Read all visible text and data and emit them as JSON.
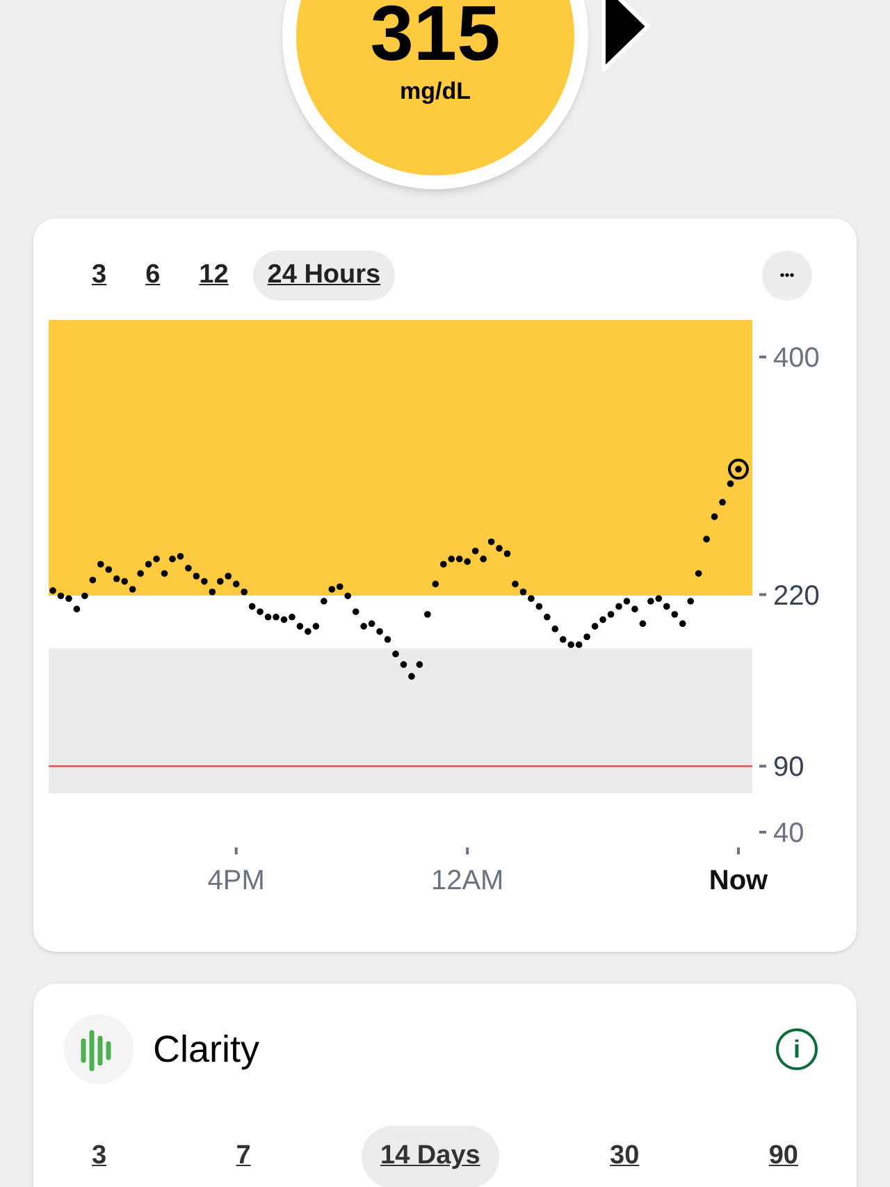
{
  "reading": {
    "value": "315",
    "unit": "mg/dL"
  },
  "graph": {
    "ranges": [
      {
        "label": "3",
        "selected": false
      },
      {
        "label": "6",
        "selected": false
      },
      {
        "label": "12",
        "selected": false
      },
      {
        "label": "24 Hours",
        "selected": true
      }
    ],
    "more": "•••",
    "chart_data": {
      "type": "scatter",
      "ylim": [
        40,
        428
      ],
      "yticks": [
        400,
        220,
        90,
        40
      ],
      "categories": [
        null,
        null,
        null,
        null,
        null,
        null,
        null,
        null,
        null,
        null,
        null,
        null,
        null,
        null,
        null,
        null,
        null,
        null,
        null,
        null,
        null,
        null,
        null,
        "4PM",
        null,
        null,
        null,
        null,
        null,
        null,
        null,
        null,
        null,
        null,
        null,
        null,
        null,
        null,
        null,
        null,
        null,
        null,
        null,
        null,
        null,
        null,
        null,
        null,
        null,
        null,
        null,
        null,
        "12AM",
        null,
        null,
        null,
        null,
        null,
        null,
        null,
        null,
        null,
        null,
        null,
        null,
        null,
        null,
        null,
        null,
        null,
        null,
        null,
        null,
        null,
        null,
        null,
        null,
        null,
        null,
        null,
        null,
        null,
        null,
        null,
        null,
        null,
        "Now"
      ],
      "series": [
        {
          "color": "#000000",
          "values": [
            223,
            219,
            217,
            209,
            219,
            231,
            243,
            239,
            232,
            230,
            224,
            236,
            243,
            247,
            236,
            247,
            249,
            240,
            234,
            230,
            222,
            230,
            234,
            228,
            222,
            211,
            207,
            203,
            203,
            201,
            203,
            196,
            192,
            196,
            215,
            224,
            226,
            219,
            207,
            196,
            198,
            192,
            186,
            175,
            167,
            158,
            167,
            205,
            228,
            243,
            247,
            247,
            245,
            253,
            247,
            260,
            255,
            251,
            228,
            222,
            217,
            211,
            203,
            194,
            186,
            182,
            182,
            188,
            196,
            201,
            205,
            211,
            215,
            209,
            198,
            215,
            217,
            211,
            205,
            198,
            215,
            236,
            262,
            279,
            290,
            304,
            315
          ]
        }
      ]
    }
  },
  "clarity": {
    "title": "Clarity",
    "info": "i",
    "ranges": [
      {
        "label": "3",
        "selected": false
      },
      {
        "label": "7",
        "selected": false
      },
      {
        "label": "14 Days",
        "selected": true
      },
      {
        "label": "30",
        "selected": false
      },
      {
        "label": "90",
        "selected": false
      }
    ]
  }
}
